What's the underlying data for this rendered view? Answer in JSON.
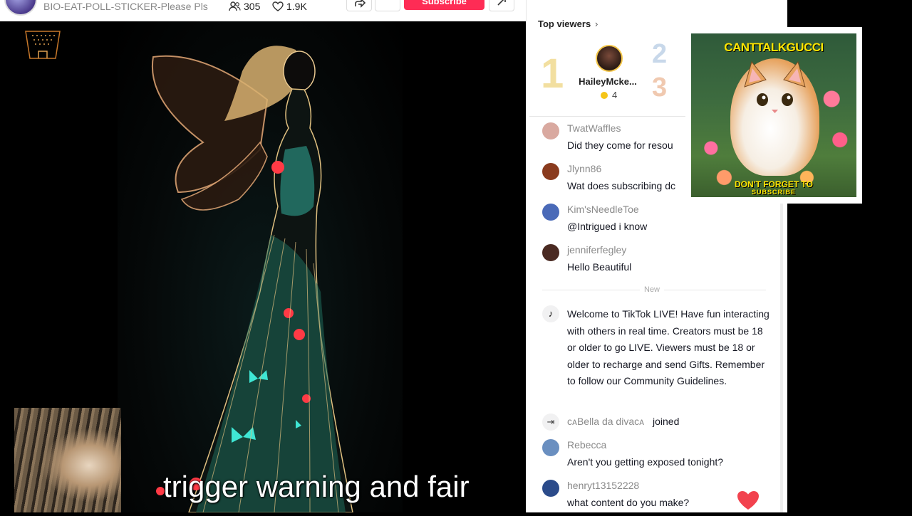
{
  "header": {
    "title": "BIO-EAT-POLL-STICKER-Please Pls",
    "viewer_count": "305",
    "like_count": "1.9K",
    "subscribe_label": "Subscribe",
    "subscribe_color": "#fe2c55"
  },
  "stream": {
    "caption": "trigger warning and fair"
  },
  "top_viewers": {
    "label": "Top viewers",
    "rank1": "1",
    "rank2": "2",
    "rank3": "3",
    "first": {
      "name": "HaileyMcke...",
      "coins": "4"
    }
  },
  "comments": [
    {
      "user": "TwatWaffles",
      "text": "Did they come for resou",
      "avatar_color": "#d9a9a0"
    },
    {
      "user": "Jlynn86",
      "text": "Wat does subscribing dc",
      "avatar_color": "#8a3b1e"
    },
    {
      "user": "Kim'sNeedleToe",
      "text": "@Intrigued i know",
      "avatar_color": "#4a6ab8"
    },
    {
      "user": "jenniferfegley",
      "text": "Hello Beautiful",
      "avatar_color": "#4a2a22"
    }
  ],
  "new_separator": "New",
  "system_message": "Welcome to TikTok LIVE! Have fun interacting with others in real time. Creators must be 18 or older to go LIVE. Viewers must be 18 or older to recharge and send Gifts. Remember to follow our Community Guidelines.",
  "join_event": {
    "user": "ᴄᴀBella da divaᴄᴀ",
    "verb": "joined"
  },
  "comments_after": [
    {
      "user": "Rebecca",
      "text": "Aren't you getting exposed tonight?",
      "avatar_color": "#6a8fc0"
    },
    {
      "user": "henryt13152228",
      "text": "what content do you make?",
      "avatar_color": "#2b4b8a"
    }
  ],
  "promo_card": {
    "title": "CANTTALKGUCCI",
    "footer_line1": "DON'T FORGET TO",
    "footer_line2": "SUBSCRIBE"
  }
}
